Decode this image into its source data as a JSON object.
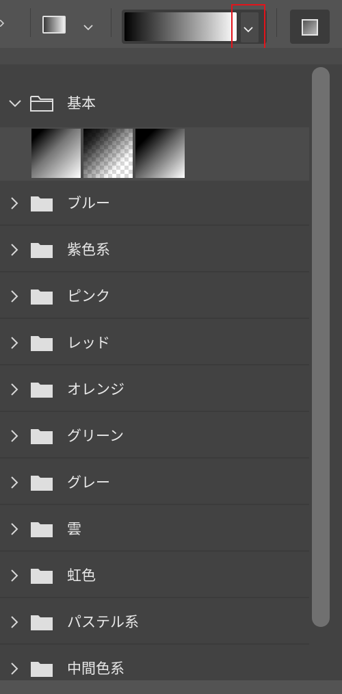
{
  "toolbar": {
    "gradient_swatch_icon": "gradient-square-icon",
    "swatch_dropdown_icon": "chevron-down-icon",
    "gradient_picker_dropdown_icon": "chevron-down-icon",
    "mode_icon": "gradient-square-icon",
    "highlight_color": "#e3141b"
  },
  "panel": {
    "open_folder": {
      "label": "基本",
      "icon": "folder-open-icon",
      "presets": [
        {
          "name": "foreground-to-background"
        },
        {
          "name": "foreground-to-transparent"
        },
        {
          "name": "black-white"
        }
      ]
    },
    "folders": [
      {
        "label": "ブルー"
      },
      {
        "label": "紫色系"
      },
      {
        "label": "ピンク"
      },
      {
        "label": "レッド"
      },
      {
        "label": "オレンジ"
      },
      {
        "label": "グリーン"
      },
      {
        "label": "グレー"
      },
      {
        "label": "雲"
      },
      {
        "label": "虹色"
      },
      {
        "label": "パステル系"
      },
      {
        "label": "中間色系"
      }
    ]
  },
  "colors": {
    "panel_bg": "#424242",
    "toolbar_bg": "#535353",
    "text": "#e8e8e8"
  }
}
